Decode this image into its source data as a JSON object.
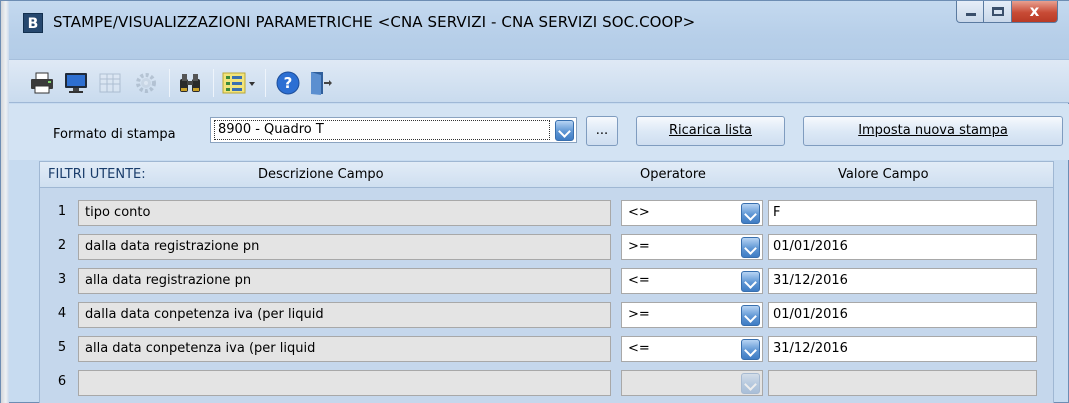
{
  "window": {
    "app_icon_letter": "B",
    "title": "STAMPE/VISUALIZZAZIONI PARAMETRICHE <CNA SERVIZI - CNA SERVIZI SOC.COOP>",
    "close_glyph": "x"
  },
  "toolbar": {
    "items": [
      {
        "icon": "printer-icon",
        "enabled": true
      },
      {
        "icon": "monitor-icon",
        "enabled": true
      },
      {
        "icon": "spreadsheet-icon",
        "enabled": false
      },
      {
        "icon": "gear-icon",
        "enabled": false
      },
      {
        "icon": "binoculars-icon",
        "enabled": true
      },
      {
        "icon": "list-dropdown-icon",
        "enabled": true
      },
      {
        "icon": "help-icon",
        "enabled": true
      },
      {
        "icon": "exit-door-icon",
        "enabled": true
      }
    ]
  },
  "form": {
    "format_label": "Formato di stampa",
    "format_value": "8900 - Quadro T",
    "dots_label": "...",
    "reload_label": "Ricarica lista",
    "new_print_label": "Imposta nuova stampa"
  },
  "grid": {
    "header": {
      "filters": "FILTRI UTENTE:",
      "description": "Descrizione Campo",
      "operator": "Operatore",
      "value": "Valore Campo"
    },
    "rows": [
      {
        "num": "1",
        "description": "tipo conto",
        "operator": "<>",
        "value": "F"
      },
      {
        "num": "2",
        "description": "dalla data registrazione pn",
        "operator": ">=",
        "value": "01/01/2016"
      },
      {
        "num": "3",
        "description": "alla data registrazione pn",
        "operator": "<=",
        "value": "31/12/2016"
      },
      {
        "num": "4",
        "description": "dalla data conpetenza iva (per liquid",
        "operator": ">=",
        "value": "01/01/2016"
      },
      {
        "num": "5",
        "description": "alla data conpetenza iva (per liquid",
        "operator": "<=",
        "value": "31/12/2016"
      },
      {
        "num": "6",
        "description": "",
        "operator": "",
        "value": ""
      }
    ]
  },
  "colors": {
    "window_bg": "#c7dbf0",
    "dropdown_blue": "#3f7cc4",
    "close_red": "#c84b36"
  }
}
